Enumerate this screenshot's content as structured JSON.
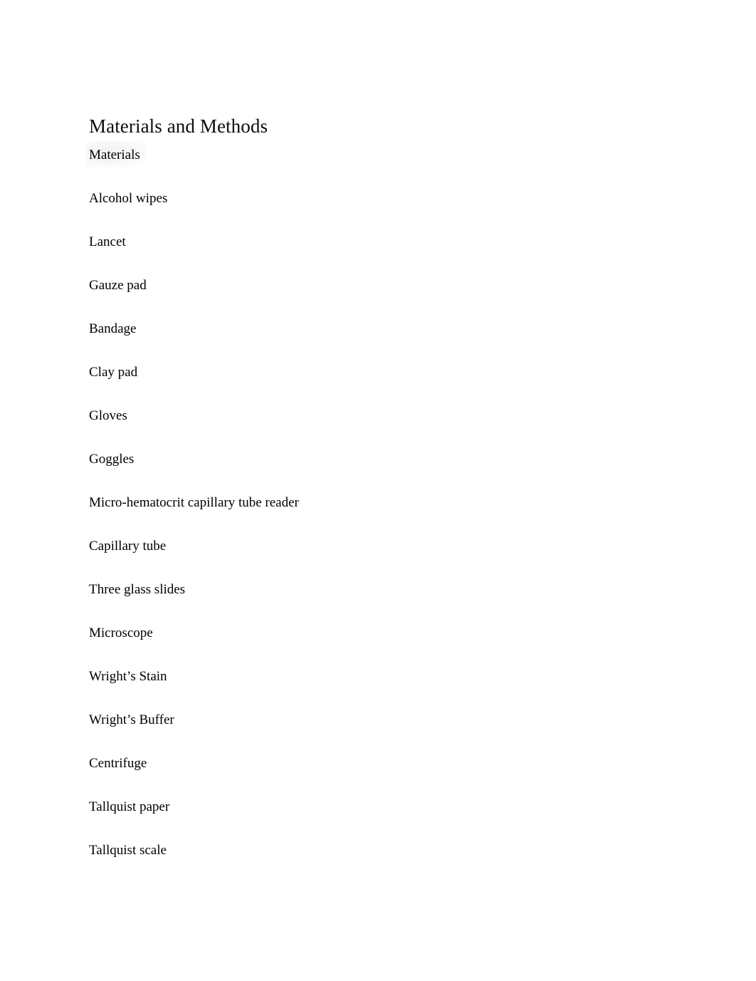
{
  "document": {
    "title": "Materials and Methods",
    "section": {
      "heading": "Materials",
      "items": [
        "Alcohol wipes",
        "Lancet",
        "Gauze pad",
        "Bandage",
        "Clay pad",
        "Gloves",
        "Goggles",
        "Micro-hematocrit capillary tube reader",
        "Capillary tube",
        "Three glass slides",
        "Microscope",
        "Wright’s Stain",
        "Wright’s Buffer",
        "Centrifuge",
        "Tallquist paper",
        "Tallquist scale"
      ]
    }
  },
  "colors": {
    "page_background": "#ffffff",
    "text": "#000000",
    "heading_highlight": "#f0f0f0"
  }
}
